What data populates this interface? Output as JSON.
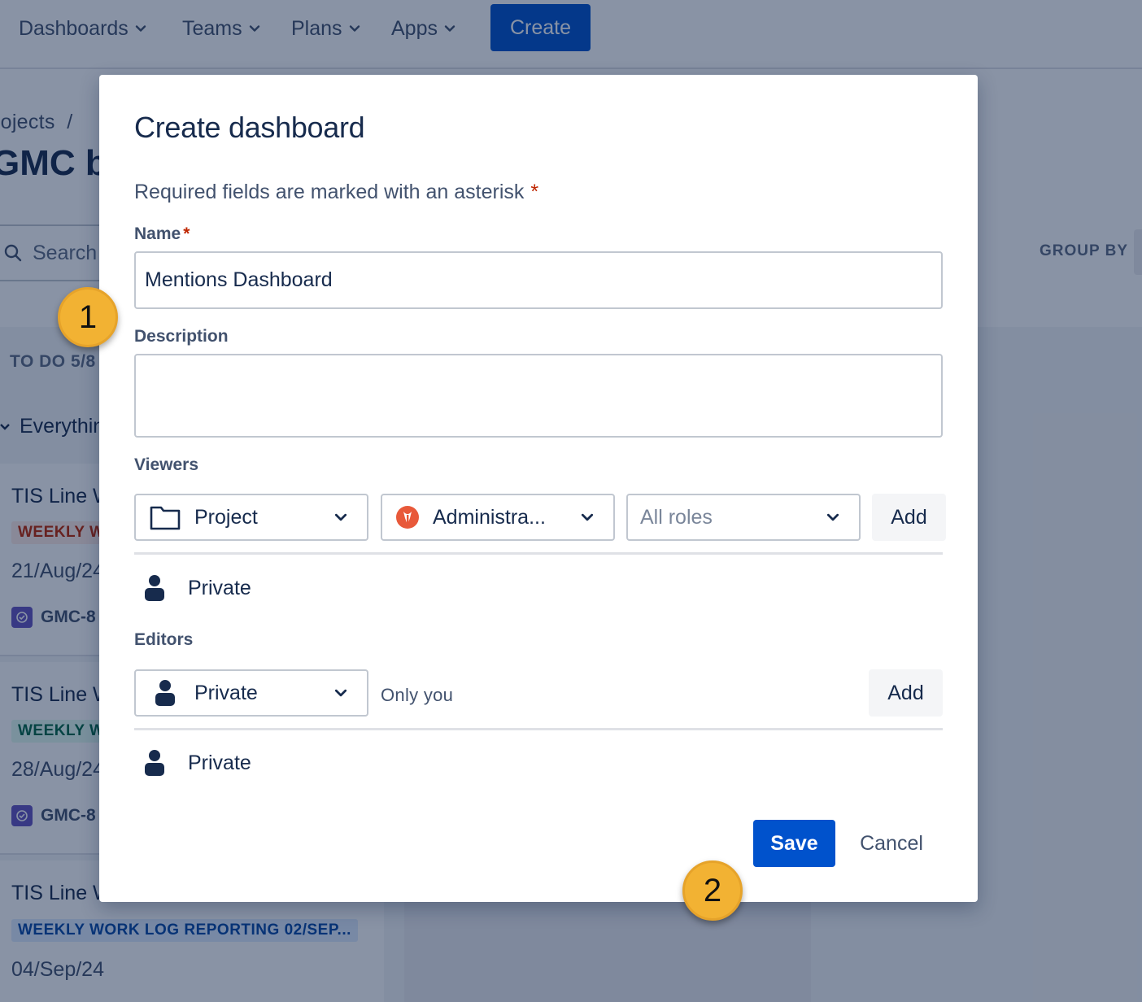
{
  "topnav": {
    "items": [
      {
        "label": "Dashboards"
      },
      {
        "label": "Teams"
      },
      {
        "label": "Plans"
      },
      {
        "label": "Apps"
      }
    ],
    "create_label": "Create"
  },
  "background": {
    "breadcrumb": "rojects  /",
    "page_title": "GMC b",
    "search_placeholder": "Search",
    "group_by_label": "GROUP BY",
    "column_header": "TO DO 5/8",
    "swimlane_label": "Everythin",
    "cards": [
      {
        "title": "TIS Line W",
        "badge": "WEEKLY W",
        "badge_bg": "#FFEBE6",
        "badge_color": "#BF2600",
        "date": "21/Aug/24",
        "key": "GMC-8"
      },
      {
        "title": "TIS Line W",
        "badge": "WEEKLY W",
        "badge_bg": "#E3FCEF",
        "badge_color": "#006644",
        "date": "28/Aug/24",
        "key": "GMC-8"
      },
      {
        "title": "TIS Line W",
        "badge": "WEEKLY WORK LOG REPORTING 02/SEP...",
        "badge_bg": "#DEEBFF",
        "badge_color": "#0747A6",
        "date": "04/Sep/24",
        "key": ""
      }
    ]
  },
  "modal": {
    "title": "Create dashboard",
    "required_note": "Required fields are marked with an asterisk",
    "required_marker": "*",
    "name_label": "Name",
    "name_value": "Mentions Dashboard",
    "description_label": "Description",
    "description_value": "",
    "viewers_label": "Viewers",
    "viewers_selects": [
      {
        "label": "Project",
        "icon": "folder-icon"
      },
      {
        "label": "Administra...",
        "icon": "project-avatar-icon"
      },
      {
        "label": "All roles",
        "icon": ""
      }
    ],
    "viewers_add": "Add",
    "viewers_current": "Private",
    "editors_label": "Editors",
    "editors_select": "Private",
    "editors_hint": "Only you",
    "editors_add": "Add",
    "editors_current": "Private",
    "save_label": "Save",
    "cancel_label": "Cancel"
  },
  "callouts": [
    "1",
    "2"
  ],
  "colors": {
    "primary": "#0052CC",
    "callout": "#F2B233",
    "required": "#BF2600"
  }
}
